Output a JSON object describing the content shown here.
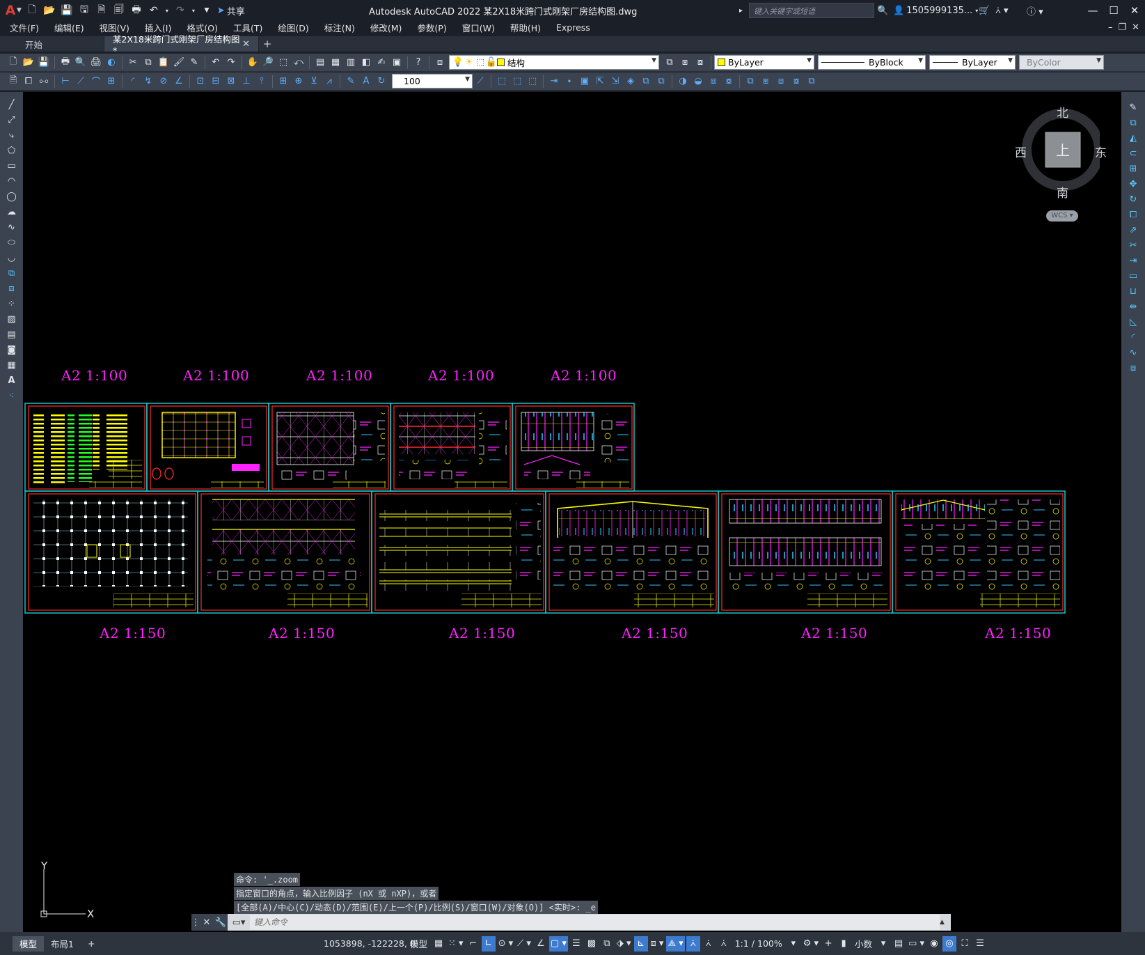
{
  "titlebar": {
    "app_title": "Autodesk AutoCAD 2022    某2X18米跨门式刚架厂房结构图.dwg",
    "search_placeholder": "键入关键字或短语",
    "user": "1505999135...",
    "share_label": "共享",
    "logo": "A"
  },
  "menu": [
    "文件(F)",
    "编辑(E)",
    "视图(V)",
    "插入(I)",
    "格式(O)",
    "工具(T)",
    "绘图(D)",
    "标注(N)",
    "修改(M)",
    "参数(P)",
    "窗口(W)",
    "帮助(H)",
    "Express"
  ],
  "tabs": {
    "start": "开始",
    "active": "某2X18米跨门式刚架厂房结构图*"
  },
  "layer_dropdown": {
    "value": "结构",
    "color": "#ffff00"
  },
  "color_dropdown": {
    "value": "ByLayer",
    "color": "#ffff00"
  },
  "linetype_dropdown": {
    "value": "ByBlock"
  },
  "lineweight_dropdown": {
    "value": "ByLayer"
  },
  "plotstyle_dropdown": {
    "value": "ByColor"
  },
  "scale_dropdown": {
    "value": "100"
  },
  "sheets_top_label": "A2 1:100",
  "sheets_bottom_label": "A2 1:150",
  "viewcube": {
    "north": "北",
    "south": "南",
    "east": "东",
    "west": "西",
    "top": "上",
    "wcs": "WCS"
  },
  "command": {
    "history": [
      "命令: '_.zoom",
      "指定窗口的角点，输入比例因子 (nX 或 nXP)，或者",
      "[全部(A)/中心(C)/动态(D)/范围(E)/上一个(P)/比例(S)/窗口(W)/对象(O)] <实时>: _e"
    ],
    "input_placeholder": "键入命令"
  },
  "ucs": {
    "x": "X",
    "y": "Y"
  },
  "status": {
    "model_tab": "模型",
    "layout_tab": "布局1",
    "coords": "1053898, -122228, 0",
    "model_label": "模型",
    "scale": "1:1 / 100%",
    "units": "小数"
  }
}
